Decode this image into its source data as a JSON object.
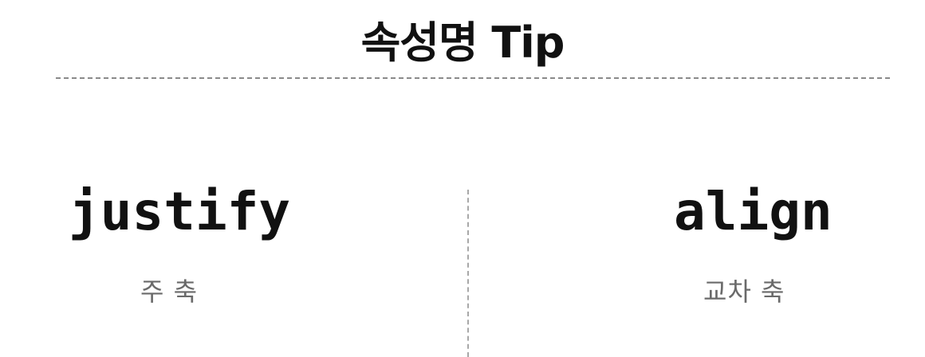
{
  "title": "속성명 Tip",
  "left": {
    "term": "justify",
    "description": "주 축"
  },
  "right": {
    "term": "align",
    "description": "교차 축"
  }
}
